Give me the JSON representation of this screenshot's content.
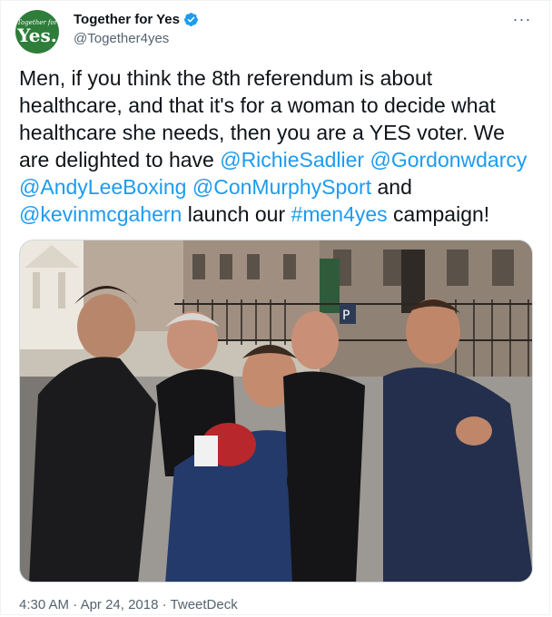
{
  "author": {
    "display_name": "Together for Yes",
    "handle": "@Together4yes",
    "verified": true,
    "avatar_text_small": "Together for",
    "avatar_text_big": "Yes.",
    "avatar_color": "#2e7d3a"
  },
  "more_icon": "more-horizontal-icon",
  "more_label": "···",
  "tweet": {
    "segments": [
      {
        "text": "Men, if you think the 8th referendum is about healthcare, and that it's for a woman to decide what healthcare she needs, then you are a YES voter. We are delighted to have ",
        "type": "text"
      },
      {
        "text": "@RichieSadlier",
        "type": "mention"
      },
      {
        "text": " ",
        "type": "text"
      },
      {
        "text": "@Gordonwdarcy",
        "type": "mention"
      },
      {
        "text": " ",
        "type": "text"
      },
      {
        "text": "@AndyLeeBoxing",
        "type": "mention"
      },
      {
        "text": " ",
        "type": "text"
      },
      {
        "text": "@ConMurphySport",
        "type": "mention"
      },
      {
        "text": " and ",
        "type": "text"
      },
      {
        "text": "@kevinmcgahern",
        "type": "mention"
      },
      {
        "text": " launch our ",
        "type": "text"
      },
      {
        "text": "#men4yes",
        "type": "hashtag"
      },
      {
        "text": " campaign!",
        "type": "text"
      }
    ]
  },
  "footer": {
    "time": "4:30 AM",
    "sep1": " · ",
    "date": "Apr 24, 2018",
    "sep2": " · ",
    "source": "TweetDeck"
  },
  "colors": {
    "link": "#1d9bf0",
    "secondary": "#536471",
    "verified": "#1d9bf0"
  }
}
